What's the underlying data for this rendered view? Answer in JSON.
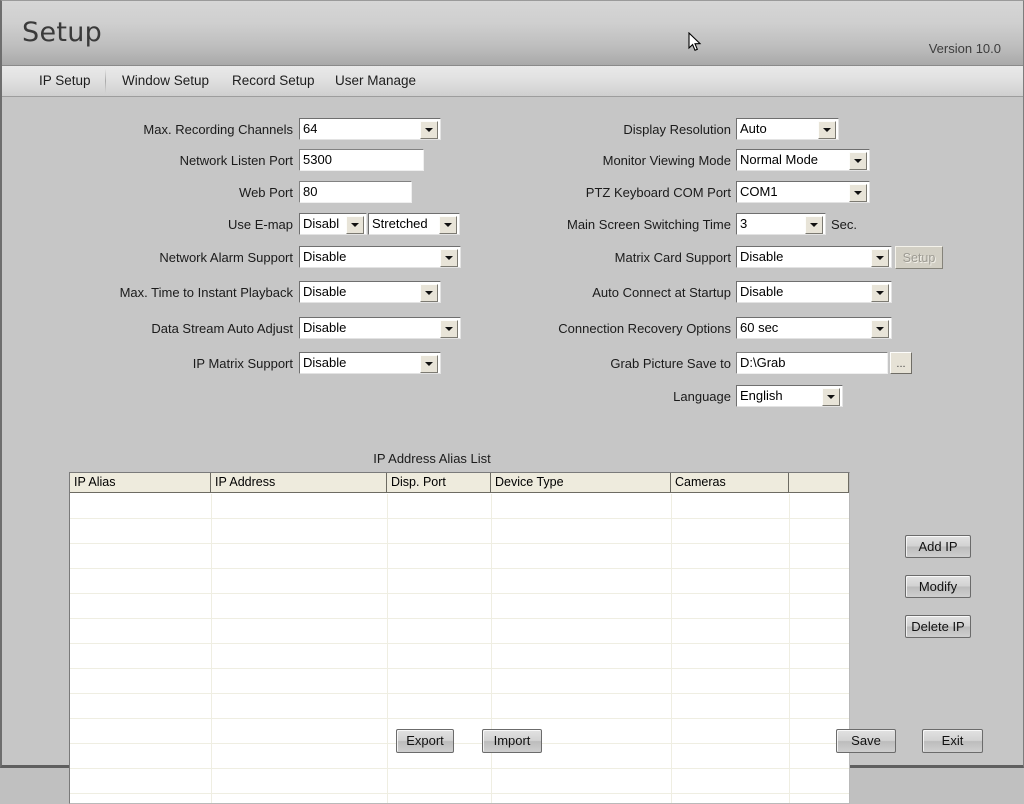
{
  "window": {
    "title": "Setup",
    "version": "Version 10.0"
  },
  "menu": {
    "items": [
      {
        "label": "IP Setup",
        "active": true
      },
      {
        "label": "Window Setup",
        "active": false
      },
      {
        "label": "Record Setup",
        "active": false
      },
      {
        "label": "User Manage",
        "active": false
      }
    ]
  },
  "form": {
    "left": [
      {
        "label": "Max. Recording Channels",
        "type": "combo",
        "value": "64"
      },
      {
        "label": "Network Listen Port",
        "type": "text",
        "value": "5300"
      },
      {
        "label": "Web Port",
        "type": "text",
        "value": "80"
      },
      {
        "label": "Use E-map",
        "type": "combo2",
        "value": "Disabl",
        "value2": "Stretched"
      },
      {
        "label": "Network Alarm Support",
        "type": "combo",
        "value": "Disable"
      },
      {
        "label": "Max. Time to Instant Playback",
        "type": "combo",
        "value": "Disable"
      },
      {
        "label": "Data Stream Auto Adjust",
        "type": "combo",
        "value": "Disable"
      },
      {
        "label": "IP Matrix Support",
        "type": "combo",
        "value": "Disable"
      }
    ],
    "right": [
      {
        "label": "Display Resolution",
        "type": "combo",
        "value": "Auto"
      },
      {
        "label": "Monitor Viewing Mode",
        "type": "combo",
        "value": "Normal Mode"
      },
      {
        "label": "PTZ Keyboard COM Port",
        "type": "combo",
        "value": "COM1"
      },
      {
        "label": "Main Screen Switching Time",
        "type": "combo",
        "value": "3",
        "suffix": "Sec."
      },
      {
        "label": "Matrix Card Support",
        "type": "combo",
        "value": "Disable",
        "extra_button": "Setup"
      },
      {
        "label": "Auto Connect at Startup",
        "type": "combo",
        "value": "Disable"
      },
      {
        "label": "Connection Recovery Options",
        "type": "combo",
        "value": "60 sec"
      },
      {
        "label": "Grab Picture Save to",
        "type": "text",
        "value": "D:\\Grab",
        "browse_button": "..."
      },
      {
        "label": "Language",
        "type": "combo",
        "value": "English"
      }
    ]
  },
  "list": {
    "caption": "IP Address Alias List",
    "columns": [
      "IP Alias",
      "IP Address",
      "Disp. Port",
      "Device Type",
      "Cameras",
      ""
    ],
    "rows": []
  },
  "side_buttons": [
    {
      "label": "Add IP"
    },
    {
      "label": "Modify"
    },
    {
      "label": "Delete IP"
    }
  ],
  "bottom_buttons": [
    {
      "label": "Export"
    },
    {
      "label": "Import"
    },
    {
      "label": "Save"
    },
    {
      "label": "Exit"
    }
  ],
  "colors": {
    "face": "#c6c6c6",
    "field": "#ffffff",
    "header": "#eeebdd",
    "text": "#1b1b1b"
  }
}
